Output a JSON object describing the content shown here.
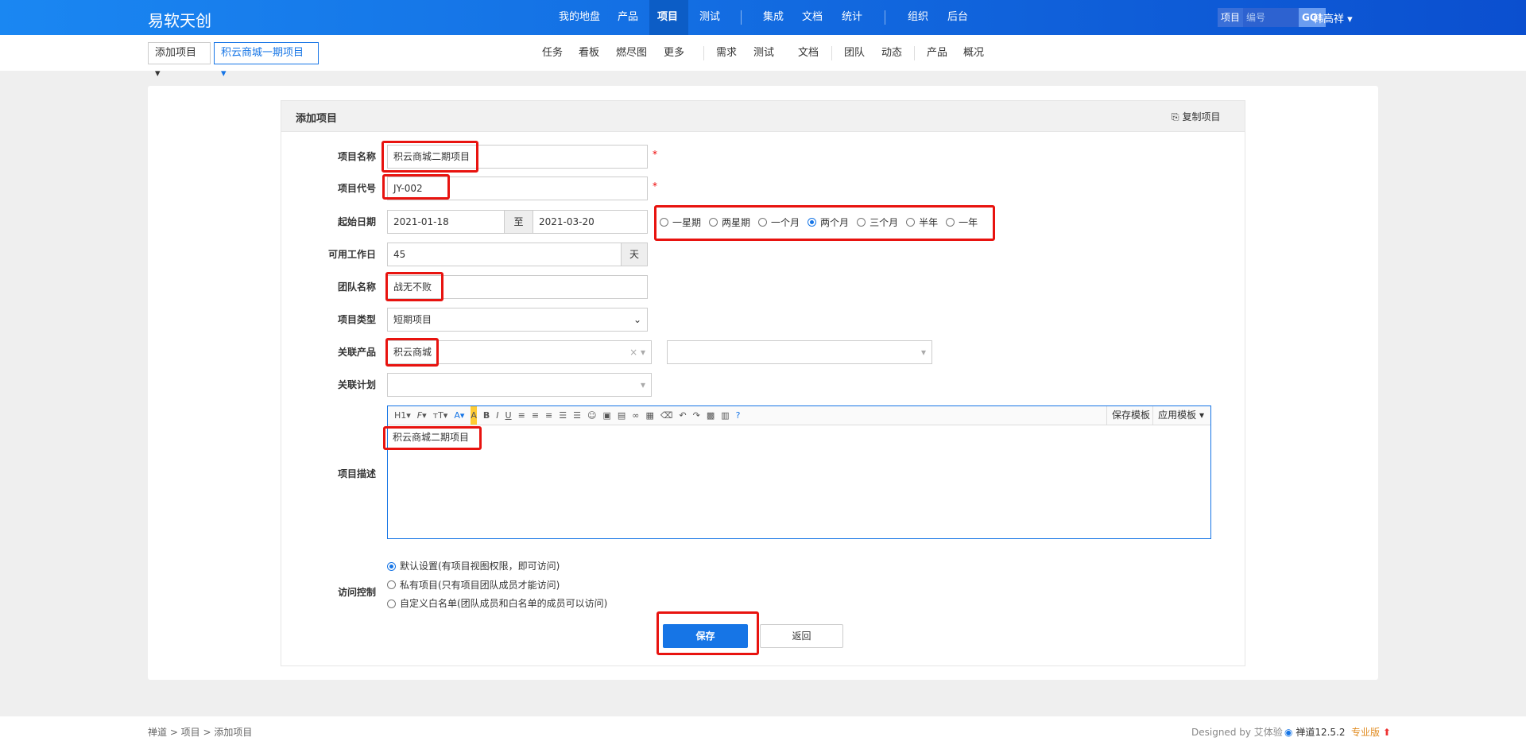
{
  "header": {
    "logo": "易软天创",
    "nav": [
      "我的地盘",
      "产品",
      "项目",
      "测试",
      "集成",
      "文档",
      "统计",
      "组织",
      "后台"
    ],
    "search_type": "项目",
    "search_placeholder": "编号(ctrl+g)",
    "go": "GO!",
    "user": "韩高祥"
  },
  "subnav": {
    "crumb1": "添加项目",
    "crumb2": "积云商城一期项目",
    "items": [
      "任务",
      "看板",
      "燃尽图",
      "更多",
      "需求",
      "测试",
      "文档",
      "团队",
      "动态",
      "产品",
      "概况"
    ]
  },
  "form": {
    "title": "添加项目",
    "copy": "复制项目",
    "name_label": "项目名称",
    "name": "积云商城二期项目",
    "code_label": "项目代号",
    "code": "JY-002",
    "date_label": "起始日期",
    "begin": "2021-01-18",
    "to": "至",
    "end": "2021-03-20",
    "durations": [
      "一星期",
      "两星期",
      "一个月",
      "两个月",
      "三个月",
      "半年",
      "一年"
    ],
    "days_label": "可用工作日",
    "days": "45",
    "days_unit": "天",
    "team_label": "团队名称",
    "team": "战无不败",
    "type_label": "项目类型",
    "type": "短期项目",
    "product_label": "关联产品",
    "product": "积云商城",
    "plan_label": "关联计划",
    "desc_label": "项目描述",
    "desc": "积云商城二期项目",
    "save_tpl": "保存模板",
    "apply_tpl": "应用模板",
    "acl_label": "访问控制",
    "acl": [
      "默认设置(有项目视图权限，即可访问)",
      "私有项目(只有项目团队成员才能访问)",
      "自定义白名单(团队成员和白名单的成员可以访问)"
    ],
    "save": "保存",
    "back": "返回"
  },
  "footer": {
    "crumbs": "禅道 > 项目 > 添加项目",
    "designed": "Designed by 艾体验",
    "version": "禅道12.5.2",
    "edition": "专业版"
  }
}
